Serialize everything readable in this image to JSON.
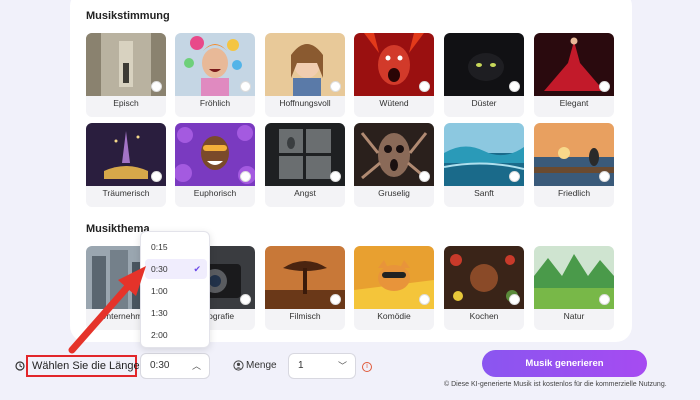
{
  "colors": {
    "accent": "#8a56f0",
    "highlight_box": "#e2262a",
    "arrow": "#e5332a"
  },
  "mood": {
    "title": "Musikstimmung",
    "tiles": [
      {
        "label": "Episch",
        "icon": "epic-image"
      },
      {
        "label": "Fröhlich",
        "icon": "happy-image"
      },
      {
        "label": "Hoffnungsvoll",
        "icon": "hopeful-image"
      },
      {
        "label": "Wütend",
        "icon": "angry-image"
      },
      {
        "label": "Düster",
        "icon": "dark-image"
      },
      {
        "label": "Elegant",
        "icon": "elegant-image"
      },
      {
        "label": "Träumerisch",
        "icon": "dreamy-image"
      },
      {
        "label": "Euphorisch",
        "icon": "euphoric-image"
      },
      {
        "label": "Angst",
        "icon": "fear-image"
      },
      {
        "label": "Gruselig",
        "icon": "creepy-image"
      },
      {
        "label": "Sanft",
        "icon": "gentle-image"
      },
      {
        "label": "Friedlich",
        "icon": "peaceful-image"
      }
    ]
  },
  "theme": {
    "title": "Musikthema",
    "tiles": [
      {
        "label": "Unternehmen",
        "icon": "business-image"
      },
      {
        "label": "Fotografie",
        "icon": "photography-image"
      },
      {
        "label": "Filmisch",
        "icon": "cinematic-image"
      },
      {
        "label": "Komödie",
        "icon": "comedy-image"
      },
      {
        "label": "Kochen",
        "icon": "cooking-image"
      },
      {
        "label": "Natur",
        "icon": "nature-image"
      }
    ]
  },
  "length_dropdown": {
    "options": [
      "0:15",
      "0:30",
      "1:00",
      "1:30",
      "2:00"
    ],
    "selected": "0:30"
  },
  "controls": {
    "length_label": "Wählen Sie die Länge",
    "length_value": "0:30",
    "quantity_label": "Menge",
    "quantity_value": "1",
    "generate_label": "Musik generieren",
    "note": "Diese KI-generierte Musik ist kostenlos für die kommerzielle Nutzung."
  }
}
